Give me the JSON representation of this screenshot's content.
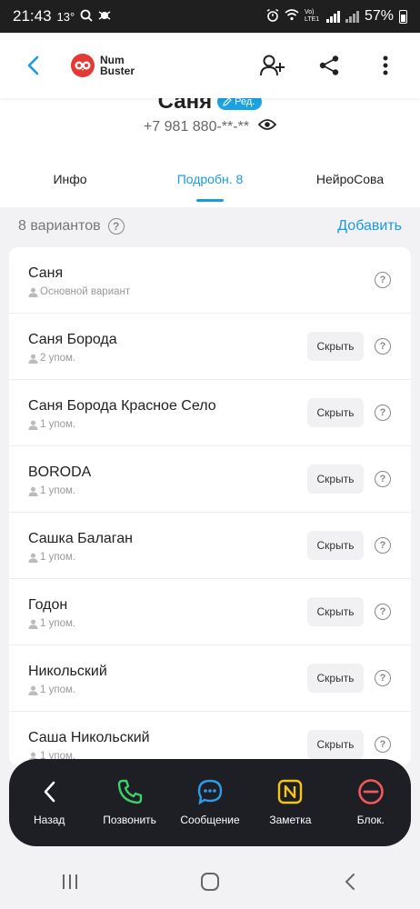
{
  "status": {
    "time": "21:43",
    "temp": "13°",
    "battery": "57%",
    "battery_level": 0.57,
    "lte_label": "Vo) LTE1"
  },
  "appbar": {
    "logo_line1": "Num",
    "logo_line2": "Buster"
  },
  "profile": {
    "name": "Саня",
    "edit_label": "Ред.",
    "phone": "+7 981 880-**-**"
  },
  "tabs": [
    {
      "label": "Инфо",
      "active": false
    },
    {
      "label": "Подробн. 8",
      "active": true
    },
    {
      "label": "НейроСова",
      "active": false
    }
  ],
  "section": {
    "count_label": "8 вариантов",
    "help": "?",
    "add_label": "Добавить"
  },
  "variants": [
    {
      "name": "Саня",
      "sub": "Основной вариант",
      "hide": ""
    },
    {
      "name": "Саня Борода",
      "sub": "2 упом.",
      "hide": "Скрыть"
    },
    {
      "name": "Саня Борода Красное Село",
      "sub": "1 упом.",
      "hide": "Скрыть"
    },
    {
      "name": "BORODA",
      "sub": "1 упом.",
      "hide": "Скрыть"
    },
    {
      "name": "Сашка Балаган",
      "sub": "1 упом.",
      "hide": "Скрыть"
    },
    {
      "name": "Годон",
      "sub": "1 упом.",
      "hide": "Скрыть"
    },
    {
      "name": "Никольский",
      "sub": "1 упом.",
      "hide": "Скрыть"
    },
    {
      "name": "Саша Никольский",
      "sub": "1 упом.",
      "hide": "Скрыть"
    }
  ],
  "actions": [
    {
      "label": "Назад",
      "icon": "chevron-left-icon",
      "color": "#ffffff"
    },
    {
      "label": "Позвонить",
      "icon": "phone-icon",
      "color": "#3ccf6a"
    },
    {
      "label": "Сообщение",
      "icon": "message-icon",
      "color": "#2f9bea"
    },
    {
      "label": "Заметка",
      "icon": "note-icon",
      "color": "#f5c518"
    },
    {
      "label": "Блок.",
      "icon": "block-icon",
      "color": "#f0595a"
    }
  ],
  "colors": {
    "accent": "#1a9be0",
    "logo": "#e53935",
    "actionbar_bg": "#1e1f24"
  }
}
